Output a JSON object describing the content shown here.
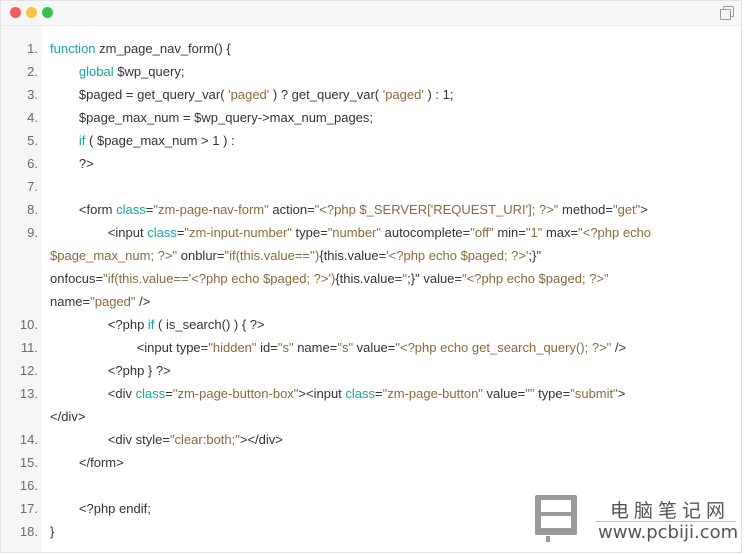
{
  "window": {
    "copy_icon": "copy-icon"
  },
  "lines": [
    {
      "no": "1.",
      "parts": [
        {
          "t": "function",
          "c": "kw"
        },
        {
          "t": " zm_page_nav_form() {"
        }
      ]
    },
    {
      "no": "2.",
      "parts": [
        {
          "t": "        "
        },
        {
          "t": "global",
          "c": "kw"
        },
        {
          "t": " $wp_query;"
        }
      ]
    },
    {
      "no": "3.",
      "parts": [
        {
          "t": "        $paged = get_query_var( "
        },
        {
          "t": "'paged'",
          "c": "st"
        },
        {
          "t": " ) ? get_query_var( "
        },
        {
          "t": "'paged'",
          "c": "st"
        },
        {
          "t": " ) : 1;"
        }
      ]
    },
    {
      "no": "4.",
      "parts": [
        {
          "t": "        $page_max_num = $wp_query->max_num_pages;"
        }
      ]
    },
    {
      "no": "5.",
      "parts": [
        {
          "t": "        "
        },
        {
          "t": "if",
          "c": "kw"
        },
        {
          "t": " ( $page_max_num > 1 ) :"
        }
      ]
    },
    {
      "no": "6.",
      "parts": [
        {
          "t": "        ?>"
        }
      ]
    },
    {
      "no": "7.",
      "parts": []
    },
    {
      "no": "8.",
      "parts": [
        {
          "t": "        <form "
        },
        {
          "t": "class",
          "c": "kw"
        },
        {
          "t": "="
        },
        {
          "t": "\"zm-page-nav-form\"",
          "c": "st"
        },
        {
          "t": " action="
        },
        {
          "t": "\"<?php $_SERVER['REQUEST_URI']; ?>\"",
          "c": "st"
        },
        {
          "t": " method="
        },
        {
          "t": "\"get\"",
          "c": "st"
        },
        {
          "t": ">"
        }
      ]
    },
    {
      "no": "9.",
      "parts": [
        {
          "t": "                <input "
        },
        {
          "t": "class",
          "c": "kw"
        },
        {
          "t": "="
        },
        {
          "t": "\"zm-input-number\"",
          "c": "st"
        },
        {
          "t": " type="
        },
        {
          "t": "\"number\"",
          "c": "st"
        },
        {
          "t": " autocomplete="
        },
        {
          "t": "\"off\"",
          "c": "st"
        },
        {
          "t": " min="
        },
        {
          "t": "\"1\"",
          "c": "st"
        },
        {
          "t": " max="
        },
        {
          "t": "\"<?php echo",
          "c": "st"
        }
      ]
    },
    {
      "no": "",
      "parts": [
        {
          "t": "$page_max_num; ?>\"",
          "c": "st"
        },
        {
          "t": " onblur="
        },
        {
          "t": "\"if(this.value=='')",
          "c": "st"
        },
        {
          "t": "{this.value="
        },
        {
          "t": "'<?php echo $paged; ?>'",
          "c": "st"
        },
        {
          "t": ";}\""
        }
      ]
    },
    {
      "no": "",
      "parts": [
        {
          "t": "onfocus="
        },
        {
          "t": "\"if(this.value=='<?php echo $paged; ?>')",
          "c": "st"
        },
        {
          "t": "{this.value="
        },
        {
          "t": "''",
          "c": "st"
        },
        {
          "t": ";}\" value="
        },
        {
          "t": "\"<?php echo $paged; ?>\"",
          "c": "st"
        }
      ]
    },
    {
      "no": "",
      "parts": [
        {
          "t": "name="
        },
        {
          "t": "\"paged\"",
          "c": "st"
        },
        {
          "t": " />"
        }
      ]
    },
    {
      "no": "10.",
      "parts": [
        {
          "t": "                <?php "
        },
        {
          "t": "if",
          "c": "kw"
        },
        {
          "t": " ( is_search() ) { ?>"
        }
      ]
    },
    {
      "no": "11.",
      "parts": [
        {
          "t": "                        <input type="
        },
        {
          "t": "\"hidden\"",
          "c": "st"
        },
        {
          "t": " id="
        },
        {
          "t": "\"s\"",
          "c": "st"
        },
        {
          "t": " name="
        },
        {
          "t": "\"s\"",
          "c": "st"
        },
        {
          "t": " value="
        },
        {
          "t": "\"<?php echo get_search_query(); ?>\"",
          "c": "st"
        },
        {
          "t": " />"
        }
      ]
    },
    {
      "no": "12.",
      "parts": [
        {
          "t": "                <?php } ?>"
        }
      ]
    },
    {
      "no": "13.",
      "parts": [
        {
          "t": "                <div "
        },
        {
          "t": "class",
          "c": "kw"
        },
        {
          "t": "="
        },
        {
          "t": "\"zm-page-button-box\"",
          "c": "st"
        },
        {
          "t": "><input "
        },
        {
          "t": "class",
          "c": "kw"
        },
        {
          "t": "="
        },
        {
          "t": "\"zm-page-button\"",
          "c": "st"
        },
        {
          "t": " value="
        },
        {
          "t": "\"\"",
          "c": "st"
        },
        {
          "t": " type="
        },
        {
          "t": "\"submit\"",
          "c": "st"
        },
        {
          "t": ">"
        }
      ]
    },
    {
      "no": "",
      "parts": [
        {
          "t": "</div>"
        }
      ]
    },
    {
      "no": "14.",
      "parts": [
        {
          "t": "                <div style="
        },
        {
          "t": "\"clear:both;\"",
          "c": "st"
        },
        {
          "t": "></div>"
        }
      ]
    },
    {
      "no": "15.",
      "parts": [
        {
          "t": "        </form>"
        }
      ]
    },
    {
      "no": "16.",
      "parts": []
    },
    {
      "no": "17.",
      "parts": [
        {
          "t": "        <?php endif;"
        }
      ]
    },
    {
      "no": "18.",
      "parts": [
        {
          "t": "}"
        }
      ]
    }
  ],
  "watermark": {
    "cn": "电脑笔记网",
    "en": "www.pcbiji.com"
  },
  "colors": {
    "keyword": "#16a7a0",
    "string": "#8a6a3a",
    "text": "#333333"
  }
}
